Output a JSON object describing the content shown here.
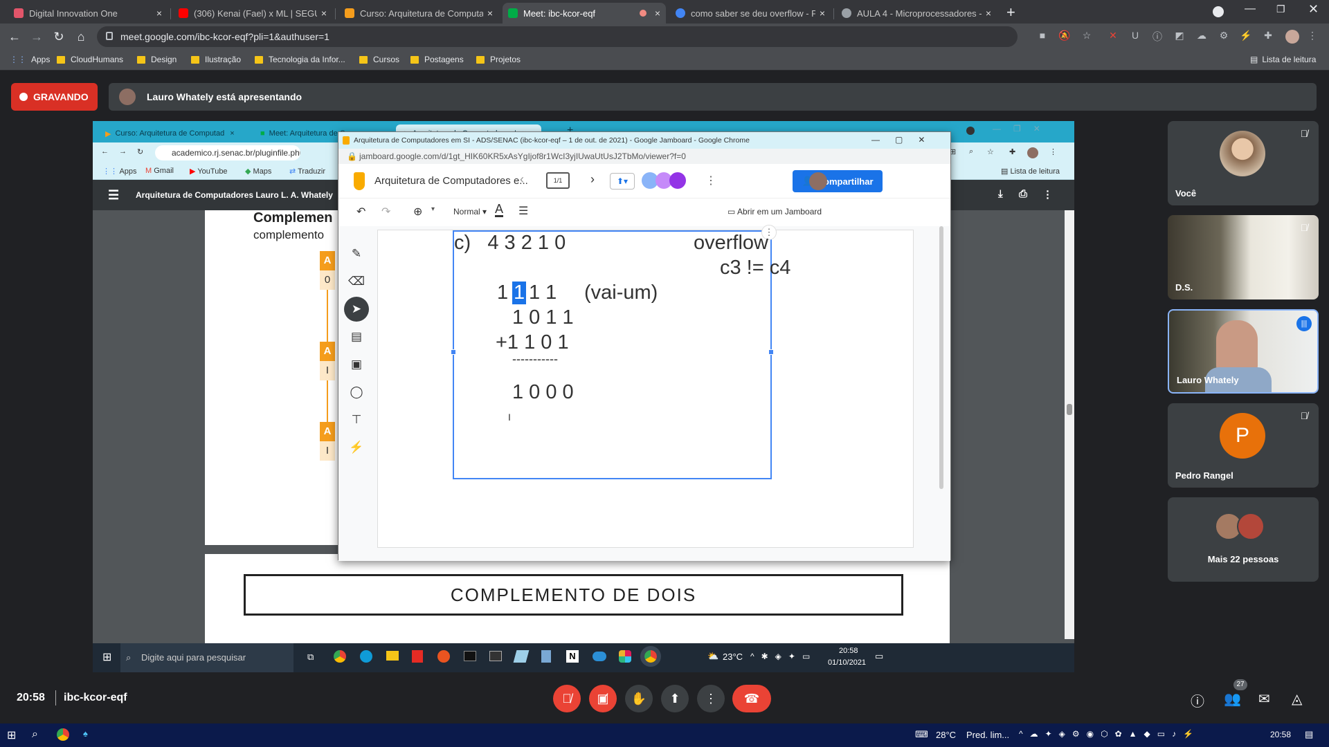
{
  "browser": {
    "tabs": [
      {
        "title": "Digital Innovation One",
        "color": "#e2556a"
      },
      {
        "title": "(306) Kenai (Fael) x ML | SEGUND",
        "color": "#ff0000"
      },
      {
        "title": "Curso: Arquitetura de Computad",
        "color": "#f59d1c"
      },
      {
        "title": "Meet: ibc-kcor-eqf",
        "color": "#00ac47"
      },
      {
        "title": "como saber se deu overflow - Pe",
        "color": "#4285f4"
      },
      {
        "title": "AULA 4 - Microprocessadores - C",
        "color": "#9aa0a6"
      }
    ],
    "url": "meet.google.com/ibc-kcor-eqf?pli=1&authuser=1",
    "bookmarks": [
      "Apps",
      "CloudHumans",
      "Design",
      "Ilustração",
      "Tecnologia da Infor...",
      "Cursos",
      "Postagens",
      "Projetos"
    ],
    "reading_list": "Lista de leitura"
  },
  "meet": {
    "recording_label": "GRAVANDO",
    "presenting_text": "Lauro Whately está apresentando",
    "time": "20:58",
    "meeting_code": "ibc-kcor-eqf",
    "participants_count": "27",
    "tiles": [
      {
        "name": "Você"
      },
      {
        "name": "D.S."
      },
      {
        "name": "Lauro Whately"
      },
      {
        "name": "Pedro Rangel",
        "initial": "P",
        "color": "#e8710a"
      },
      {
        "name": "Mais 22 pessoas"
      }
    ]
  },
  "shared": {
    "inner_tabs": [
      "Curso: Arquitetura de Computad",
      "Meet: Arquitetura de Comp",
      "Arquitetura de Computadores I"
    ],
    "inner_url": "academico.rj.senac.br/pluginfile.php/33",
    "inner_bookmarks": [
      "Apps",
      "Gmail",
      "YouTube",
      "Maps",
      "Traduzir"
    ],
    "inner_reading": "Lista de leitura",
    "pdf_title": "Arquitetura de Computadores Lauro L. A. Whately",
    "page_heading": "Complemen",
    "page_sub": "complemento",
    "letters": [
      "A",
      "A",
      "A"
    ],
    "values": [
      "0",
      "I",
      "I"
    ],
    "page2_title": "COMPLEMENTO DE DOIS",
    "jam_window_title": "Arquitetura de Computadores em SI - ADS/SENAC (ibc-kcor-eqf – 1 de out. de 2021) - Google Jamboard - Google Chrome",
    "jam_url": "jamboard.google.com/d/1gt_HIK60KR5xAsYgIjof8r1WcI3yjIUwaUtUsJ2TbMo/viewer?f=0",
    "jam_doc_title": "Arquitetura de Computadores e...",
    "jam_frame": "1/1",
    "jam_share": "Compartilhar",
    "jam_font": "Normal",
    "jam_open": "Abrir em um Jamboard",
    "hw": {
      "line1": "c)   4 3 2 1 0",
      "overflow": "overflow",
      "cond": "c3 != c4",
      "carry_a": "1",
      "carry_b": "1",
      "carry_c": "1 1",
      "carry_label": "(vai-um)",
      "op1": "1 0 1 1",
      "op2": "+1 1 0 1",
      "rule": "-----------",
      "result": "1 0 0 0"
    },
    "search_placeholder": "Digite aqui para pesquisar",
    "weather": "23°C",
    "clock_time": "20:58",
    "clock_date": "01/10/2021"
  },
  "windows": {
    "weather": "28°C",
    "weather_text": "Pred. lim...",
    "time": "20:58"
  }
}
